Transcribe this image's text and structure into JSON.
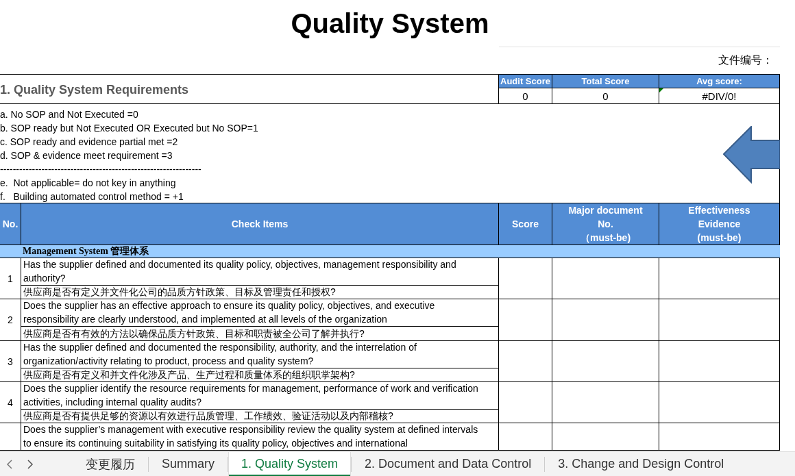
{
  "title": "Quality System",
  "doc_number_label": "文件编号：",
  "section_heading": "1. Quality System Requirements",
  "summary": {
    "columns": [
      "Audit Score",
      "Total Score",
      "Avg score:"
    ],
    "values": [
      {
        "text": "0",
        "comment": false
      },
      {
        "text": "0",
        "comment": false
      },
      {
        "text": "#DIV/0!",
        "comment": true
      }
    ]
  },
  "legend": [
    "a. No SOP and Not Executed =0",
    "b. SOP ready but Not Executed OR Executed but No SOP=1",
    "c. SOP ready and evidence partial met =2",
    "d. SOP & evidence meet requirement =3",
    "---------------------------------------------------------------",
    "e.  Not applicable= do not key in anything",
    "f.   Building automated control method = +1"
  ],
  "table": {
    "columns": [
      "No.",
      "Check Items",
      "Score",
      "Major document\nNo.\n（must-be)",
      "Effectiveness\nEvidence\n(must-be)"
    ],
    "groups": [
      {
        "title": "Management System 管理体系",
        "rows": [
          {
            "no": "1",
            "en": "Has the supplier defined and documented its quality policy, objectives, management responsibility and authority?",
            "zh": "供应商是否有定义并文件化公司的品质方针政策、目标及管理责任和授权?"
          },
          {
            "no": "2",
            "en": "Does the supplier has an effective approach to ensure its quality policy, objectives, and executive responsibility are clearly understood, and implemented at all levels of the organization",
            "zh": "供应商是否有有效的方法以确保品质方针政策、目标和职责被全公司了解并执行?"
          },
          {
            "no": "3",
            "en": "Has the supplier defined and documented the responsibility, authority, and the interrelation of organization/activity relating to product, process and quality system?",
            "zh": "供应商是否有定义和并文件化涉及产品、生产过程和质量体系的组织职掌架构?"
          },
          {
            "no": "4",
            "en": "Does the supplier identify the resource requirements for management, performance of work and verification activities, including internal quality audits?",
            "zh": "供应商是否有提供足够的资源以有效进行品质管理、工作绩效、验证活动以及内部稽核?"
          },
          {
            "en": "Does the supplier’s management with executive responsibility review the quality system at defined intervals to ensure its continuing suitability in satisfying its quality policy, objectives and international"
          }
        ]
      }
    ]
  },
  "sheet_tabs": [
    {
      "label": "变更履历",
      "selected": false
    },
    {
      "label": "Summary",
      "selected": false
    },
    {
      "label": "1. Quality System",
      "selected": true
    },
    {
      "label": "2. Document and Data Control",
      "selected": false
    },
    {
      "label": "3. Change and Design Control",
      "selected": false
    }
  ]
}
